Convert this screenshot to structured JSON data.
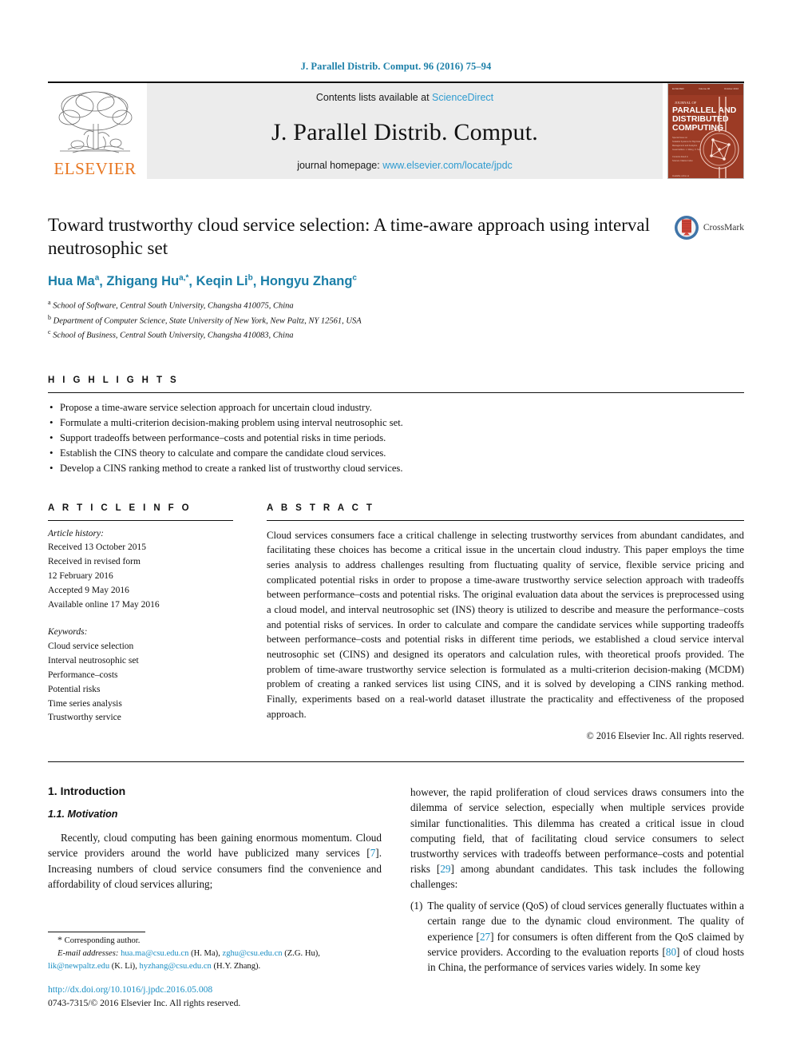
{
  "running_head": "J. Parallel Distrib. Comput. 96 (2016) 75–94",
  "masthead": {
    "publisher": "ELSEVIER",
    "contents_prefix": "Contents lists available at ",
    "contents_link": "ScienceDirect",
    "journal_title": "J. Parallel Distrib. Comput.",
    "homepage_prefix": "journal homepage: ",
    "homepage_url": "www.elsevier.com/locate/jpdc",
    "cover_lines": [
      "JOURNAL OF",
      "PARALLEL AND",
      "DISTRIBUTED",
      "COMPUTING"
    ]
  },
  "article": {
    "title": "Toward trustworthy cloud service selection: A time-aware approach using interval neutrosophic set",
    "crossmark_label": "CrossMark",
    "authors": "Hua Ma a, Zhigang Hu a,*, Keqin Li b, Hongyu Zhang c",
    "author_list": [
      {
        "name": "Hua Ma",
        "sup": "a"
      },
      {
        "name": "Zhigang Hu",
        "sup": "a,*"
      },
      {
        "name": "Keqin Li",
        "sup": "b"
      },
      {
        "name": "Hongyu Zhang",
        "sup": "c"
      }
    ],
    "affiliations": [
      {
        "sup": "a",
        "text": "School of Software, Central South University, Changsha 410075, China"
      },
      {
        "sup": "b",
        "text": "Department of Computer Science, State University of New York, New Paltz, NY 12561, USA"
      },
      {
        "sup": "c",
        "text": "School of Business, Central South University, Changsha 410083, China"
      }
    ]
  },
  "highlights": {
    "heading": "H I G H L I G H T S",
    "items": [
      "Propose a time-aware service selection approach for uncertain cloud industry.",
      "Formulate a multi-criterion decision-making problem using interval neutrosophic set.",
      "Support tradeoffs between performance–costs and potential risks in time periods.",
      "Establish the CINS theory to calculate and compare the candidate cloud services.",
      "Develop a CINS ranking method to create a ranked list of trustworthy cloud services."
    ]
  },
  "article_info": {
    "heading": "A R T I C L E    I N F O",
    "history_label": "Article history:",
    "history": [
      "Received 13 October 2015",
      "Received in revised form",
      "12 February 2016",
      "Accepted 9 May 2016",
      "Available online 17 May 2016"
    ],
    "keywords_label": "Keywords:",
    "keywords": [
      "Cloud service selection",
      "Interval neutrosophic set",
      "Performance–costs",
      "Potential risks",
      "Time series analysis",
      "Trustworthy service"
    ]
  },
  "abstract": {
    "heading": "A B S T R A C T",
    "text": "Cloud services consumers face a critical challenge in selecting trustworthy services from abundant candidates, and facilitating these choices has become a critical issue in the uncertain cloud industry. This paper employs the time series analysis to address challenges resulting from fluctuating quality of service, flexible service pricing and complicated potential risks in order to propose a time-aware trustworthy service selection approach with tradeoffs between performance–costs and potential risks. The original evaluation data about the services is preprocessed using a cloud model, and interval neutrosophic set (INS) theory is utilized to describe and measure the performance–costs and potential risks of services. In order to calculate and compare the candidate services while supporting tradeoffs between performance–costs and potential risks in different time periods, we established a cloud service interval neutrosophic set (CINS) and designed its operators and calculation rules, with theoretical proofs provided. The problem of time-aware trustworthy service selection is formulated as a multi-criterion decision-making (MCDM) problem of creating a ranked services list using CINS, and it is solved by developing a CINS ranking method. Finally, experiments based on a real-world dataset illustrate the practicality and effectiveness of the proposed approach.",
    "copyright": "© 2016 Elsevier Inc. All rights reserved."
  },
  "body": {
    "section_number_title": "1.  Introduction",
    "subsection_title": "1.1.  Motivation",
    "left_para_1a": "Recently, cloud computing has been gaining enormous momentum. Cloud service providers around the world have publicized many services [",
    "left_ref_7": "7",
    "left_para_1b": "]. Increasing numbers of cloud service consumers find the convenience and affordability of cloud services alluring;",
    "right_para_1a": "however, the rapid proliferation of cloud services draws consumers into the dilemma of service selection, especially when multiple services provide similar functionalities. This dilemma has created a critical issue in cloud computing field, that of facilitating cloud service consumers to select trustworthy services with tradeoffs between performance–costs and potential risks [",
    "right_ref_29": "29",
    "right_para_1b": "] among abundant candidates. This task includes the following challenges:",
    "item_1_number": "(1)",
    "item_1a": "The quality of service (QoS) of cloud services generally fluctuates within a certain range due to the dynamic cloud environment. The quality of experience [",
    "item_1_ref_27": "27",
    "item_1b": "] for consumers is often different from the QoS claimed by service providers. According to the evaluation reports [",
    "item_1_ref_80": "80",
    "item_1c": "] of cloud hosts in China, the performance of services varies widely. In some key"
  },
  "footnote": {
    "star": "*",
    "corresponding": "Corresponding author.",
    "email_label": "E-mail addresses:",
    "emails": [
      {
        "address": "hua.ma@csu.edu.cn",
        "who": "(H. Ma)"
      },
      {
        "address": "zghu@csu.edu.cn",
        "who": "(Z.G. Hu)"
      },
      {
        "address": "lik@newpaltz.edu",
        "who": "(K. Li)"
      },
      {
        "address": "hyzhang@csu.edu.cn",
        "who": "(H.Y. Zhang)"
      }
    ],
    "doi": "http://dx.doi.org/10.1016/j.jpdc.2016.05.008",
    "issn_line": "0743-7315/© 2016 Elsevier Inc. All rights reserved."
  },
  "colors": {
    "link": "#1b8fc4",
    "heading_blue": "#1b7fa8",
    "elsevier_orange": "#e87722",
    "masthead_bg": "#ececec",
    "cover_red": "#9c3b25"
  }
}
